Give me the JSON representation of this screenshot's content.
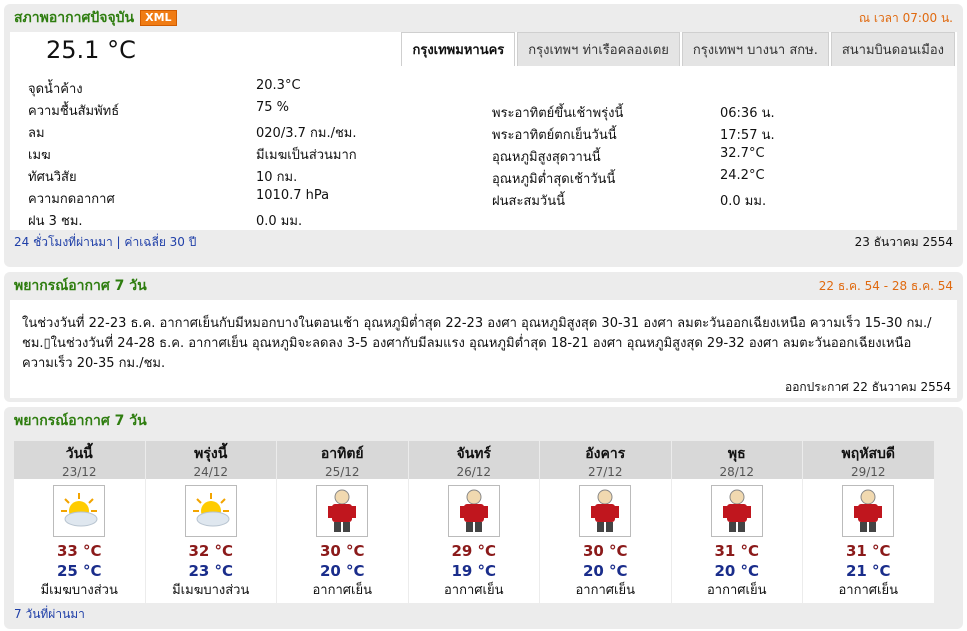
{
  "current": {
    "title": "สภาพอากาศปัจจุบัน",
    "xml_label": "XML",
    "time_label": "ณ เวลา 07:00 น.",
    "temperature": "25.1 °C",
    "tabs": [
      {
        "label": "กรุงเทพมหานคร",
        "active": true
      },
      {
        "label": "กรุงเทพฯ ท่าเรือคลองเตย",
        "active": false
      },
      {
        "label": "กรุงเทพฯ บางนา สกษ.",
        "active": false
      },
      {
        "label": "สนามบินดอนเมือง",
        "active": false
      }
    ],
    "left_rows": [
      {
        "label": "จุดน้ำค้าง",
        "value": "20.3°C"
      },
      {
        "label": "ความชื้นสัมพัทธ์",
        "value": "75 %"
      },
      {
        "label": "ลม",
        "value": "020/3.7 กม./ชม."
      },
      {
        "label": "เมฆ",
        "value": "มีเมฆเป็นส่วนมาก"
      },
      {
        "label": "ทัศนวิสัย",
        "value": "10 กม."
      },
      {
        "label": "ความกดอากาศ",
        "value": "1010.7 hPa"
      },
      {
        "label": "ฝน 3 ชม.",
        "value": "0.0 มม."
      }
    ],
    "right_rows": [
      {
        "label": "พระอาทิตย์ขึ้นเช้าพรุ่งนี้",
        "value": "06:36 น."
      },
      {
        "label": "พระอาทิตย์ตกเย็นวันนี้",
        "value": "17:57 น."
      },
      {
        "label": "อุณหภูมิสูงสุดวานนี้",
        "value": "32.7°C"
      },
      {
        "label": "อุณหภูมิต่ำสุดเช้าวันนี้",
        "value": "24.2°C"
      },
      {
        "label": "ฝนสะสมวันนี้",
        "value": "0.0 มม."
      }
    ],
    "link_past24": "24 ชั่วโมงที่ผ่านมา",
    "separator": "|",
    "link_avg30": "ค่าเฉลี่ย 30 ปี",
    "date": "23 ธันวาคม 2554"
  },
  "forecast_text": {
    "title": "พยากรณ์อากาศ 7 วัน",
    "range": "22 ธ.ค. 54 - 28 ธ.ค. 54",
    "body": "ในช่วงวันที่ 22-23 ธ.ค. อากาศเย็นกับมีหมอกบางในตอนเช้า อุณหภูมิต่ำสุด 22-23 องศา อุณหภูมิสูงสุด 30-31 องศา ลมตะวันออกเฉียงเหนือ ความเร็ว 15-30 กม./ชม.▯ในช่วงวันที่ 24-28 ธ.ค. อากาศเย็น อุณหภูมิจะลดลง 3-5 องศากับมีลมแรง อุณหภูมิต่ำสุด 18-21 องศา อุณหภูมิสูงสุด 29-32 องศา ลมตะวันออกเฉียงเหนือ ความเร็ว 20-35 กม./ชม.",
    "issued": "ออกประกาศ 22 ธันวาคม 2554"
  },
  "forecast_days": {
    "title": "พยากรณ์อากาศ 7 วัน",
    "days": [
      {
        "name": "วันนี้",
        "date": "23/12",
        "icon": "partly-cloudy-icon",
        "high": "33 °C",
        "low": "25 °C",
        "cond": "มีเมฆบางส่วน"
      },
      {
        "name": "พรุ่งนี้",
        "date": "24/12",
        "icon": "partly-cloudy-icon",
        "high": "32 °C",
        "low": "23 °C",
        "cond": "มีเมฆบางส่วน"
      },
      {
        "name": "อาทิตย์",
        "date": "25/12",
        "icon": "cold-person-icon",
        "high": "30 °C",
        "low": "20 °C",
        "cond": "อากาศเย็น"
      },
      {
        "name": "จันทร์",
        "date": "26/12",
        "icon": "cold-person-icon",
        "high": "29 °C",
        "low": "19 °C",
        "cond": "อากาศเย็น"
      },
      {
        "name": "อังคาร",
        "date": "27/12",
        "icon": "cold-person-icon",
        "high": "30 °C",
        "low": "20 °C",
        "cond": "อากาศเย็น"
      },
      {
        "name": "พุธ",
        "date": "28/12",
        "icon": "cold-person-icon",
        "high": "31 °C",
        "low": "20 °C",
        "cond": "อากาศเย็น"
      },
      {
        "name": "พฤหัสบดี",
        "date": "29/12",
        "icon": "cold-person-icon",
        "high": "31 °C",
        "low": "21 °C",
        "cond": "อากาศเย็น"
      }
    ],
    "link_past7": "7 วันที่ผ่านมา"
  },
  "colors": {
    "title_green": "#2e7d0f",
    "accent_orange": "#e06a10",
    "high_red": "#8b1a1a",
    "low_blue": "#1a2d8b",
    "link_blue": "#1f3fa8"
  }
}
